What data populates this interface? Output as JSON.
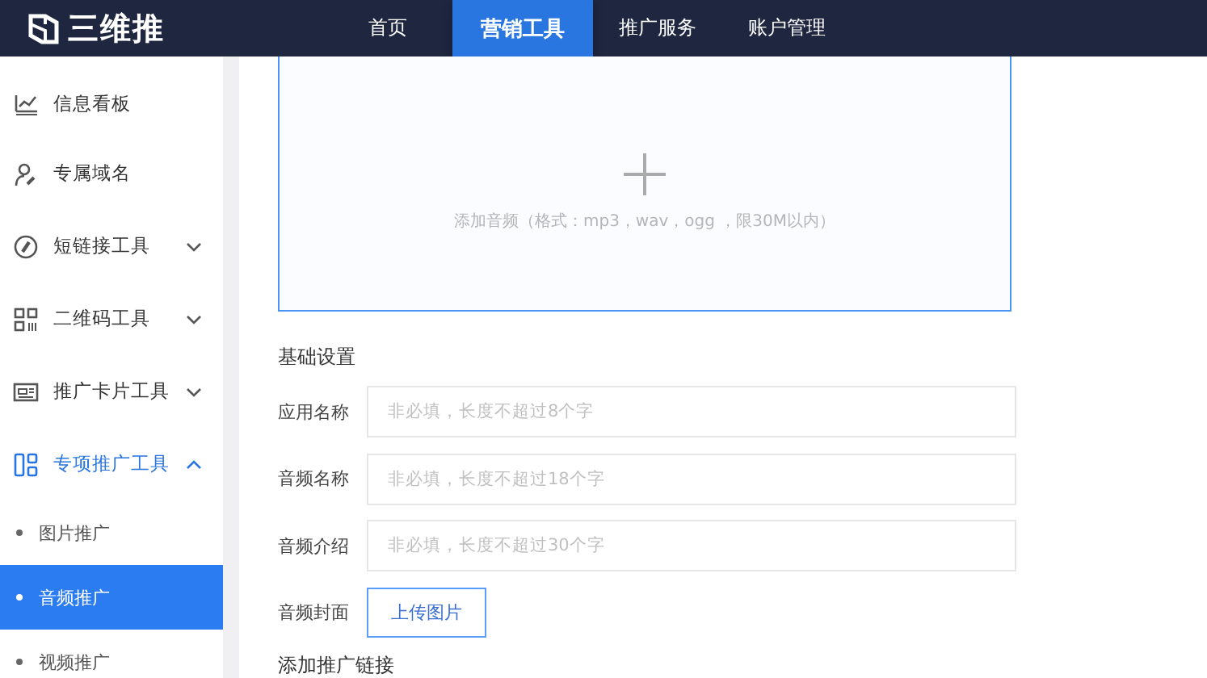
{
  "brand": {
    "name": "三维推"
  },
  "nav": [
    {
      "label": "首页",
      "selected": false
    },
    {
      "label": "营销工具",
      "selected": true
    },
    {
      "label": "推广服务",
      "selected": false
    },
    {
      "label": "账户管理",
      "selected": false
    }
  ],
  "sidebar": {
    "items": [
      {
        "label": "信息看板"
      },
      {
        "label": "专属域名"
      },
      {
        "label": "短链接工具",
        "expanded": false
      },
      {
        "label": "二维码工具",
        "expanded": false
      },
      {
        "label": "推广卡片工具",
        "expanded": false
      },
      {
        "label": "专项推广工具",
        "expanded": true,
        "children": [
          {
            "label": "图片推广",
            "selected": false
          },
          {
            "label": "音频推广",
            "selected": true
          },
          {
            "label": "视频推广",
            "selected": false
          }
        ]
      }
    ]
  },
  "upload": {
    "hint": "添加音频（格式：mp3，wav，ogg ，限30M以内）"
  },
  "basic_settings": {
    "title": "基础设置",
    "fields": [
      {
        "label": "应用名称",
        "kind": "input",
        "placeholder": "非必填，长度不超过8个字"
      },
      {
        "label": "音频名称",
        "kind": "input",
        "placeholder": "非必填，长度不超过18个字"
      },
      {
        "label": "音频介绍",
        "kind": "input",
        "placeholder": "非必填，长度不超过30个字"
      },
      {
        "label": "音频封面",
        "kind": "upload",
        "button": "上传图片"
      }
    ]
  },
  "next_section": {
    "title": "添加推广链接"
  }
}
